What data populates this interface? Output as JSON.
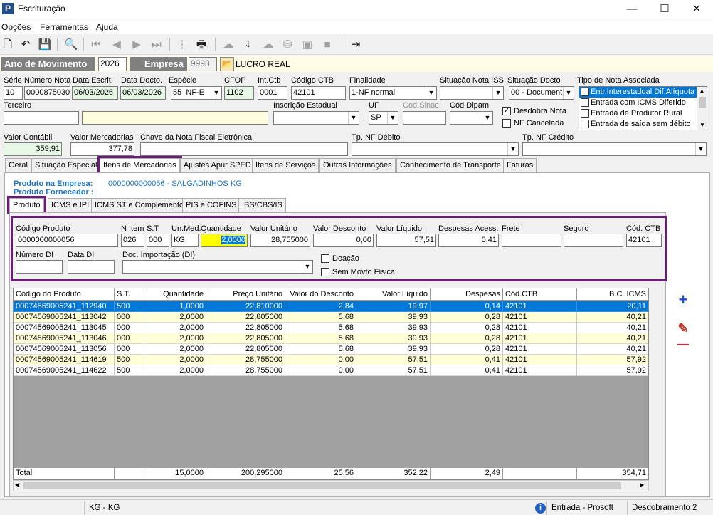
{
  "window": {
    "title": "Escrituração",
    "minimize": "—",
    "maximize": "☐",
    "close": "✕",
    "app_icon": "P"
  },
  "menu": [
    "Opções",
    "Ferramentas",
    "Ajuda"
  ],
  "toolbar_icons": [
    "new-doc-icon",
    "undo-icon",
    "save-icon",
    "preview-icon",
    "first-icon",
    "prev-icon",
    "next-icon",
    "last-icon",
    "tree-icon",
    "print-icon",
    "cloud-icon",
    "download-icon",
    "cloud2-icon",
    "db-icon",
    "car-icon",
    "box-icon",
    "exit-icon"
  ],
  "year": {
    "label": "Ano de Movimento",
    "value": "2026",
    "empresa_label": "Empresa",
    "empresa_code": "9998",
    "empresa_name": "LUCRO REAL"
  },
  "header": {
    "serie": {
      "label": "Série",
      "value": "10"
    },
    "numero_nota": {
      "label": "Número Nota",
      "value": "0000875030"
    },
    "data_escrit": {
      "label": "Data Escrit.",
      "value": "06/03/2026"
    },
    "data_docto": {
      "label": "Data Docto.",
      "value": "06/03/2026"
    },
    "especie": {
      "label": "Espécie",
      "code": "55",
      "value": "NF-E"
    },
    "cfop": {
      "label": "CFOP",
      "value": "1102"
    },
    "int_ctb": {
      "label": "Int.Ctb",
      "value": "0001"
    },
    "codigo_ctb": {
      "label": "Código CTB",
      "value": "42101"
    },
    "finalidade": {
      "label": "Finalidade",
      "value": "1-NF normal"
    },
    "situacao_iss": {
      "label": "Situação Nota ISS",
      "value": ""
    },
    "situacao_docto": {
      "label": "Situação Docto",
      "value": "00 - Document"
    },
    "tipo_nota": {
      "label": "Tipo de Nota Associada",
      "items": [
        "Entr.Interestadual Dif.Alíquota",
        "Entrada com ICMS Diferido",
        "Entrada de Produtor Rural",
        "Entrada de saída sem débito"
      ]
    },
    "terceiro": {
      "label": "Terceiro",
      "value": ""
    },
    "inscricao": {
      "label": "Inscrição Estadual",
      "value": ""
    },
    "uf": {
      "label": "UF",
      "value": "SP"
    },
    "cod_sinac": {
      "label": "Cod.Sinac",
      "value": ""
    },
    "cod_dipam": {
      "label": "Cód.Dipam",
      "value": ""
    },
    "desdobra": {
      "label": "Desdobra Nota",
      "checked": "✓"
    },
    "cancelada": {
      "label": "NF Cancelada"
    },
    "valor_contabil": {
      "label": "Valor Contábil",
      "value": "359,91"
    },
    "valor_mercadorias": {
      "label": "Valor Mercadorias",
      "value": "377,78"
    },
    "chave": {
      "label": "Chave da Nota Fiscal Eletrônica",
      "value": ""
    },
    "tp_debito": {
      "label": "Tp. NF Débito",
      "value": ""
    },
    "tp_credito": {
      "label": "Tp. NF Crédito",
      "value": ""
    }
  },
  "tabs": [
    "Geral",
    "Situação Especial",
    "Itens de Mercadorias",
    "Ajustes Apur SPED",
    "Itens de Serviços",
    "Outras Informações",
    "Conhecimento de Transporte",
    "Faturas"
  ],
  "produto_info": {
    "empresa_label": "Produto na Empresa:",
    "empresa_value": "0000000000056 - SALGADINHOS KG",
    "fornecedor_label": "Produto Fornecedor :",
    "fornecedor_value": ""
  },
  "subtabs": [
    "Produto",
    "ICMS e IPI",
    "ICMS ST e Complemento",
    "PIS e COFINS",
    "IBS/CBS/IS"
  ],
  "item": {
    "codigo_produto": {
      "label": "Código Produto",
      "value": "0000000000056"
    },
    "n_item": {
      "label": "N Item",
      "value": "026"
    },
    "st": {
      "label": "S.T.",
      "value": "000"
    },
    "un_med": {
      "label": "Un.Med.",
      "value": "KG"
    },
    "quantidade": {
      "label": "Quantidade",
      "value": "2,0000"
    },
    "valor_unitario": {
      "label": "Valor Unitário",
      "value": "28,755000"
    },
    "valor_desconto": {
      "label": "Valor Desconto",
      "value": "0,00"
    },
    "valor_liquido": {
      "label": "Valor Líquido",
      "value": "57,51"
    },
    "despesas": {
      "label": "Despesas Acess.",
      "value": "0,41"
    },
    "frete": {
      "label": "Frete",
      "value": ""
    },
    "seguro": {
      "label": "Seguro",
      "value": ""
    },
    "cod_ctb": {
      "label": "Cód. CTB",
      "value": "42101"
    },
    "numero_di": {
      "label": "Número DI",
      "value": ""
    },
    "data_di": {
      "label": "Data DI",
      "value": ""
    },
    "doc_importacao": {
      "label": "Doc. Importação (DI)",
      "value": ""
    },
    "doacao": {
      "label": "Doação"
    },
    "sem_movto": {
      "label": "Sem Movto Física"
    }
  },
  "grid": {
    "columns": [
      "Código do Produto",
      "S.T.",
      "Quantidade",
      "Preço Unitário",
      "Valor do Desconto",
      "Valor Líquido",
      "Despesas",
      "Cód.CTB",
      "B.C. ICMS"
    ],
    "rows": [
      [
        "00074569005241_112940",
        "500",
        "1,0000",
        "22,810000",
        "2,84",
        "19,97",
        "0,14",
        "42101",
        "20,11"
      ],
      [
        "00074569005241_113042",
        "000",
        "2,0000",
        "22,805000",
        "5,68",
        "39,93",
        "0,28",
        "42101",
        "40,21"
      ],
      [
        "00074569005241_113045",
        "000",
        "2,0000",
        "22,805000",
        "5,68",
        "39,93",
        "0,28",
        "42101",
        "40,21"
      ],
      [
        "00074569005241_113046",
        "000",
        "2,0000",
        "22,805000",
        "5,68",
        "39,93",
        "0,28",
        "42101",
        "40,21"
      ],
      [
        "00074569005241_113056",
        "000",
        "2,0000",
        "22,805000",
        "5,68",
        "39,93",
        "0,28",
        "42101",
        "40,21"
      ],
      [
        "00074569005241_114619",
        "500",
        "2,0000",
        "28,755000",
        "0,00",
        "57,51",
        "0,41",
        "42101",
        "57,92"
      ],
      [
        "00074569005241_114622",
        "500",
        "2,0000",
        "28,755000",
        "0,00",
        "57,51",
        "0,41",
        "42101",
        "57,92"
      ]
    ],
    "total": [
      "Total",
      "",
      "15,0000",
      "200,295000",
      "25,56",
      "352,22",
      "2,49",
      "",
      "354,71"
    ],
    "selected_row": 0
  },
  "side_buttons": {
    "add": "+",
    "edit": "✎",
    "remove": "—"
  },
  "status": {
    "unit": "KG - KG",
    "info_icon": "i",
    "mode": "Entrada - Prosoft",
    "desdobramento": "Desdobramento 2"
  },
  "colors": {
    "selected_row": "#0078d7",
    "highlight_outline": "#6a1b7a",
    "link_blue": "#1a73c8"
  }
}
